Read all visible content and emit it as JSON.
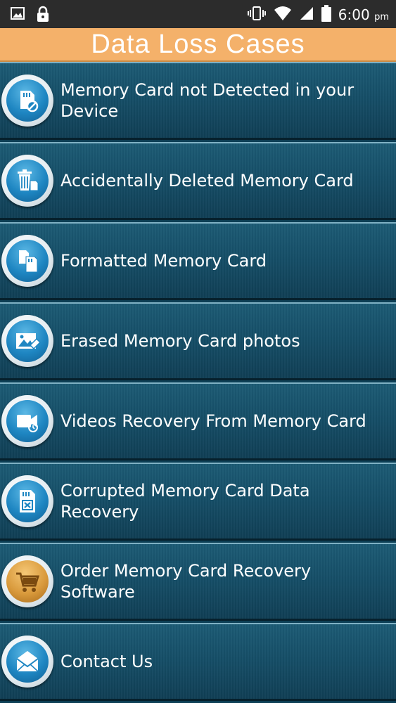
{
  "status_bar": {
    "time": "6:00",
    "ampm": "pm",
    "icons": [
      "image-icon",
      "lock-icon",
      "vibrate-icon",
      "wifi-icon",
      "signal-icon",
      "battery-icon"
    ]
  },
  "header": {
    "title": "Data Loss Cases",
    "color": "#f4b16a"
  },
  "menu": {
    "items": [
      {
        "label": "Memory Card not Detected in your Device",
        "icon": "sd-card-blocked-icon"
      },
      {
        "label": "Accidentally Deleted Memory Card",
        "icon": "trash-card-icon"
      },
      {
        "label": "Formatted Memory Card",
        "icon": "sd-cards-icon"
      },
      {
        "label": "Erased Memory Card photos",
        "icon": "photo-eraser-icon"
      },
      {
        "label": "Videos Recovery From Memory Card",
        "icon": "video-camera-icon"
      },
      {
        "label": "Corrupted Memory Card Data Recovery",
        "icon": "corrupted-card-icon"
      },
      {
        "label": "Order Memory Card Recovery Software",
        "icon": "shopping-cart-icon"
      },
      {
        "label": "Contact Us",
        "icon": "envelope-icon"
      }
    ]
  }
}
